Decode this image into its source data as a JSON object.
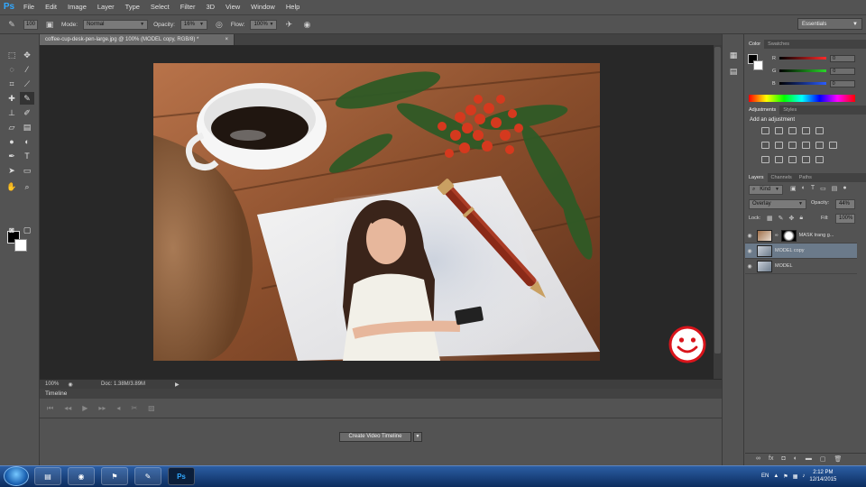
{
  "app": {
    "logo": "Ps"
  },
  "menu": [
    "File",
    "Edit",
    "Image",
    "Layer",
    "Type",
    "Select",
    "Filter",
    "3D",
    "View",
    "Window",
    "Help"
  ],
  "options": {
    "brush_size": "100",
    "mode_label": "Mode:",
    "mode_value": "Normal",
    "opacity_label": "Opacity:",
    "opacity_value": "16%",
    "flow_label": "Flow:",
    "flow_value": "100%"
  },
  "workspace": "Essentials",
  "document": {
    "tab_title": "coffee-cup-desk-pen-large.jpg @ 100% (MODEL copy, RGB/8) *",
    "zoom": "100%",
    "doc_info": "Doc: 1.38M/3.89M"
  },
  "timeline": {
    "title": "Timeline",
    "create_button": "Create Video Timeline"
  },
  "color_panel": {
    "tabs": [
      "Color",
      "Swatches"
    ],
    "channels": [
      {
        "label": "R",
        "value": "0",
        "color": "#ff2a2a"
      },
      {
        "label": "G",
        "value": "0",
        "color": "#2ad52a"
      },
      {
        "label": "B",
        "value": "0",
        "color": "#2a5cff"
      }
    ]
  },
  "adjustments_panel": {
    "tabs": [
      "Adjustments",
      "Styles"
    ],
    "heading": "Add an adjustment"
  },
  "layers_panel": {
    "tabs": [
      "Layers",
      "Channels",
      "Paths"
    ],
    "kind": "Kind",
    "blend_mode": "Overlay",
    "opacity_label": "Opacity:",
    "opacity_value": "44%",
    "lock_label": "Lock:",
    "fill_label": "Fill:",
    "fill_value": "100%",
    "layers": [
      {
        "name": "MASK trang g..."
      },
      {
        "name": "MODEL copy"
      },
      {
        "name": "MODEL"
      }
    ]
  },
  "taskbar": {
    "language": "EN",
    "time": "2:12 PM",
    "date": "12/14/2015"
  },
  "colors": {
    "panel": "#535353",
    "canvas_bg": "#282828",
    "selection": "#6b7a8a",
    "smiley_red": "#d9141b"
  }
}
